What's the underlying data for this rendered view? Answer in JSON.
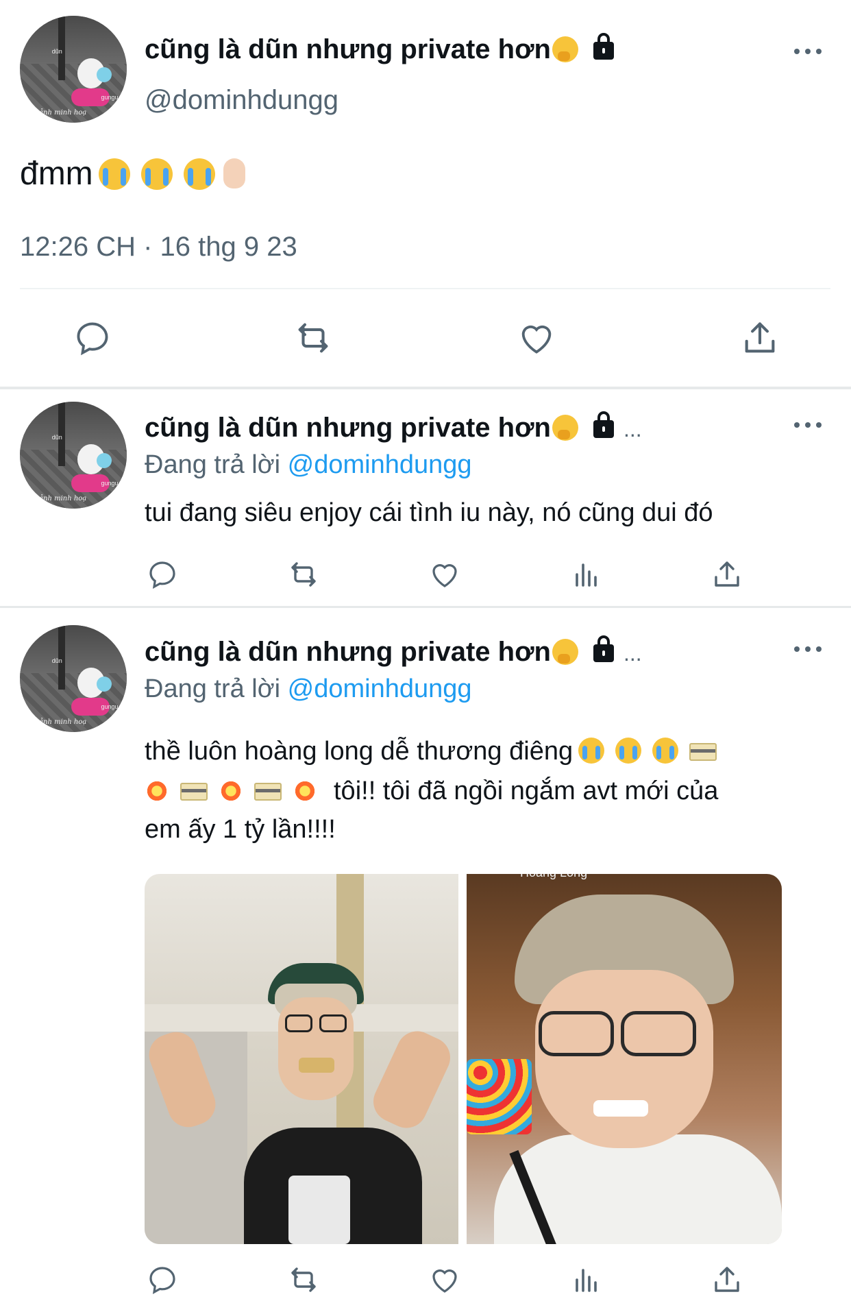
{
  "main_tweet": {
    "display_name": "cũng là dũn nhưng private hơn",
    "handle": "@dominhdungg",
    "text": "đmm",
    "timestamp": "12:26 CH · 16 thg 9 23",
    "avatar_caption": "ảnh minh hoạ",
    "avatar_small_1": "dũn",
    "avatar_small_2": "gungu"
  },
  "replies": [
    {
      "display_name": "cũng là dũn nhưng private hơn",
      "replying_label": "Đang trả lời",
      "replying_to": "@dominhdungg",
      "text": "tui đang siêu enjoy cái tình iu này, nó cũng dui đó",
      "ellipsis": "..."
    },
    {
      "display_name": "cũng là dũn nhưng private hơn",
      "replying_label": "Đang trả lời",
      "replying_to": "@dominhdungg",
      "text_line1": "thề luôn hoàng long dễ thương điêng",
      "text_line2": "tôi!! tôi đã ngồi ngắm avt mới của",
      "text_line3": "em ấy 1 tỷ lần!!!!",
      "ellipsis": "...",
      "photo_right_caption": "Hoang Long"
    }
  ],
  "colors": {
    "text": "#0f1419",
    "secondary": "#536471",
    "accent": "#1d9bf0",
    "divider": "#eff3f4"
  },
  "icons": [
    "reply-icon",
    "retweet-icon",
    "like-icon",
    "views-icon",
    "share-icon",
    "more-icon",
    "lock-icon"
  ]
}
